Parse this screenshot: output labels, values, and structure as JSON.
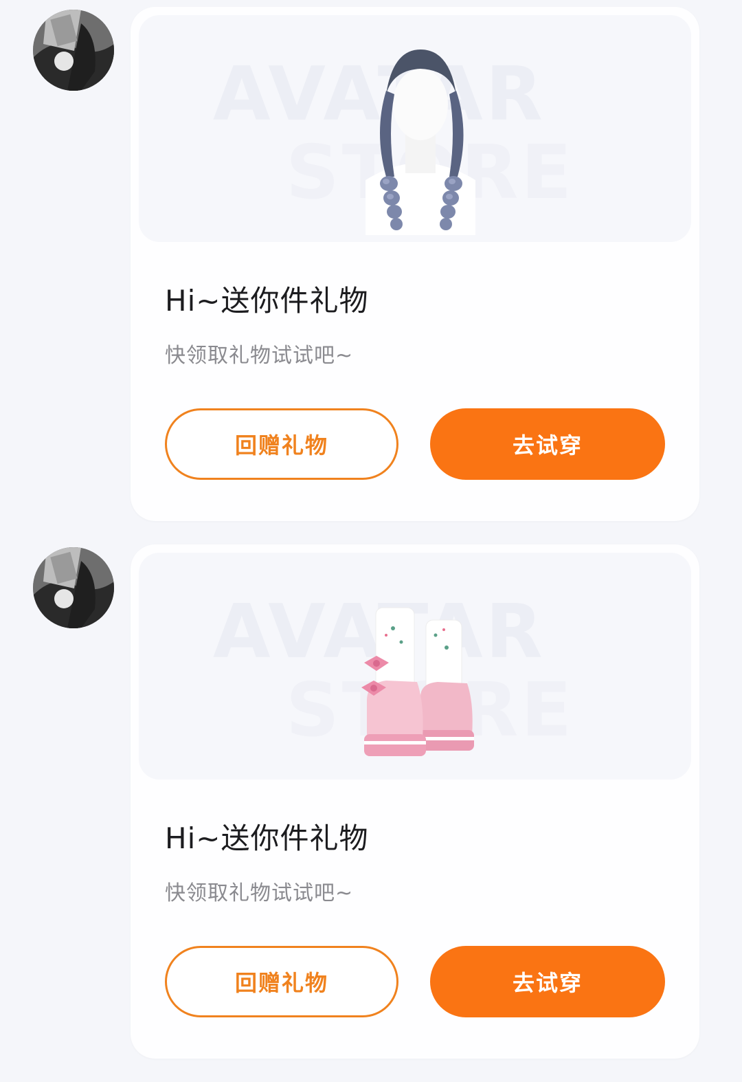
{
  "colors": {
    "accent": "#fa7413",
    "accent_outline": "#f0821e",
    "page_bg": "#f5f6fa",
    "card_bg": "#fefeff"
  },
  "messages": [
    {
      "avatar_icon": "user-avatar",
      "item_icon": "braided-hair-item",
      "watermark_line1": "AVATAR",
      "watermark_line2": "STORE",
      "title": "Hi~送你件礼物",
      "subtitle": "快领取礼物试试吧~",
      "return_gift_label": "回赠礼物",
      "try_on_label": "去试穿"
    },
    {
      "avatar_icon": "user-avatar",
      "item_icon": "pink-boots-item",
      "watermark_line1": "AVATAR",
      "watermark_line2": "STORE",
      "title": "Hi~送你件礼物",
      "subtitle": "快领取礼物试试吧~",
      "return_gift_label": "回赠礼物",
      "try_on_label": "去试穿"
    }
  ]
}
